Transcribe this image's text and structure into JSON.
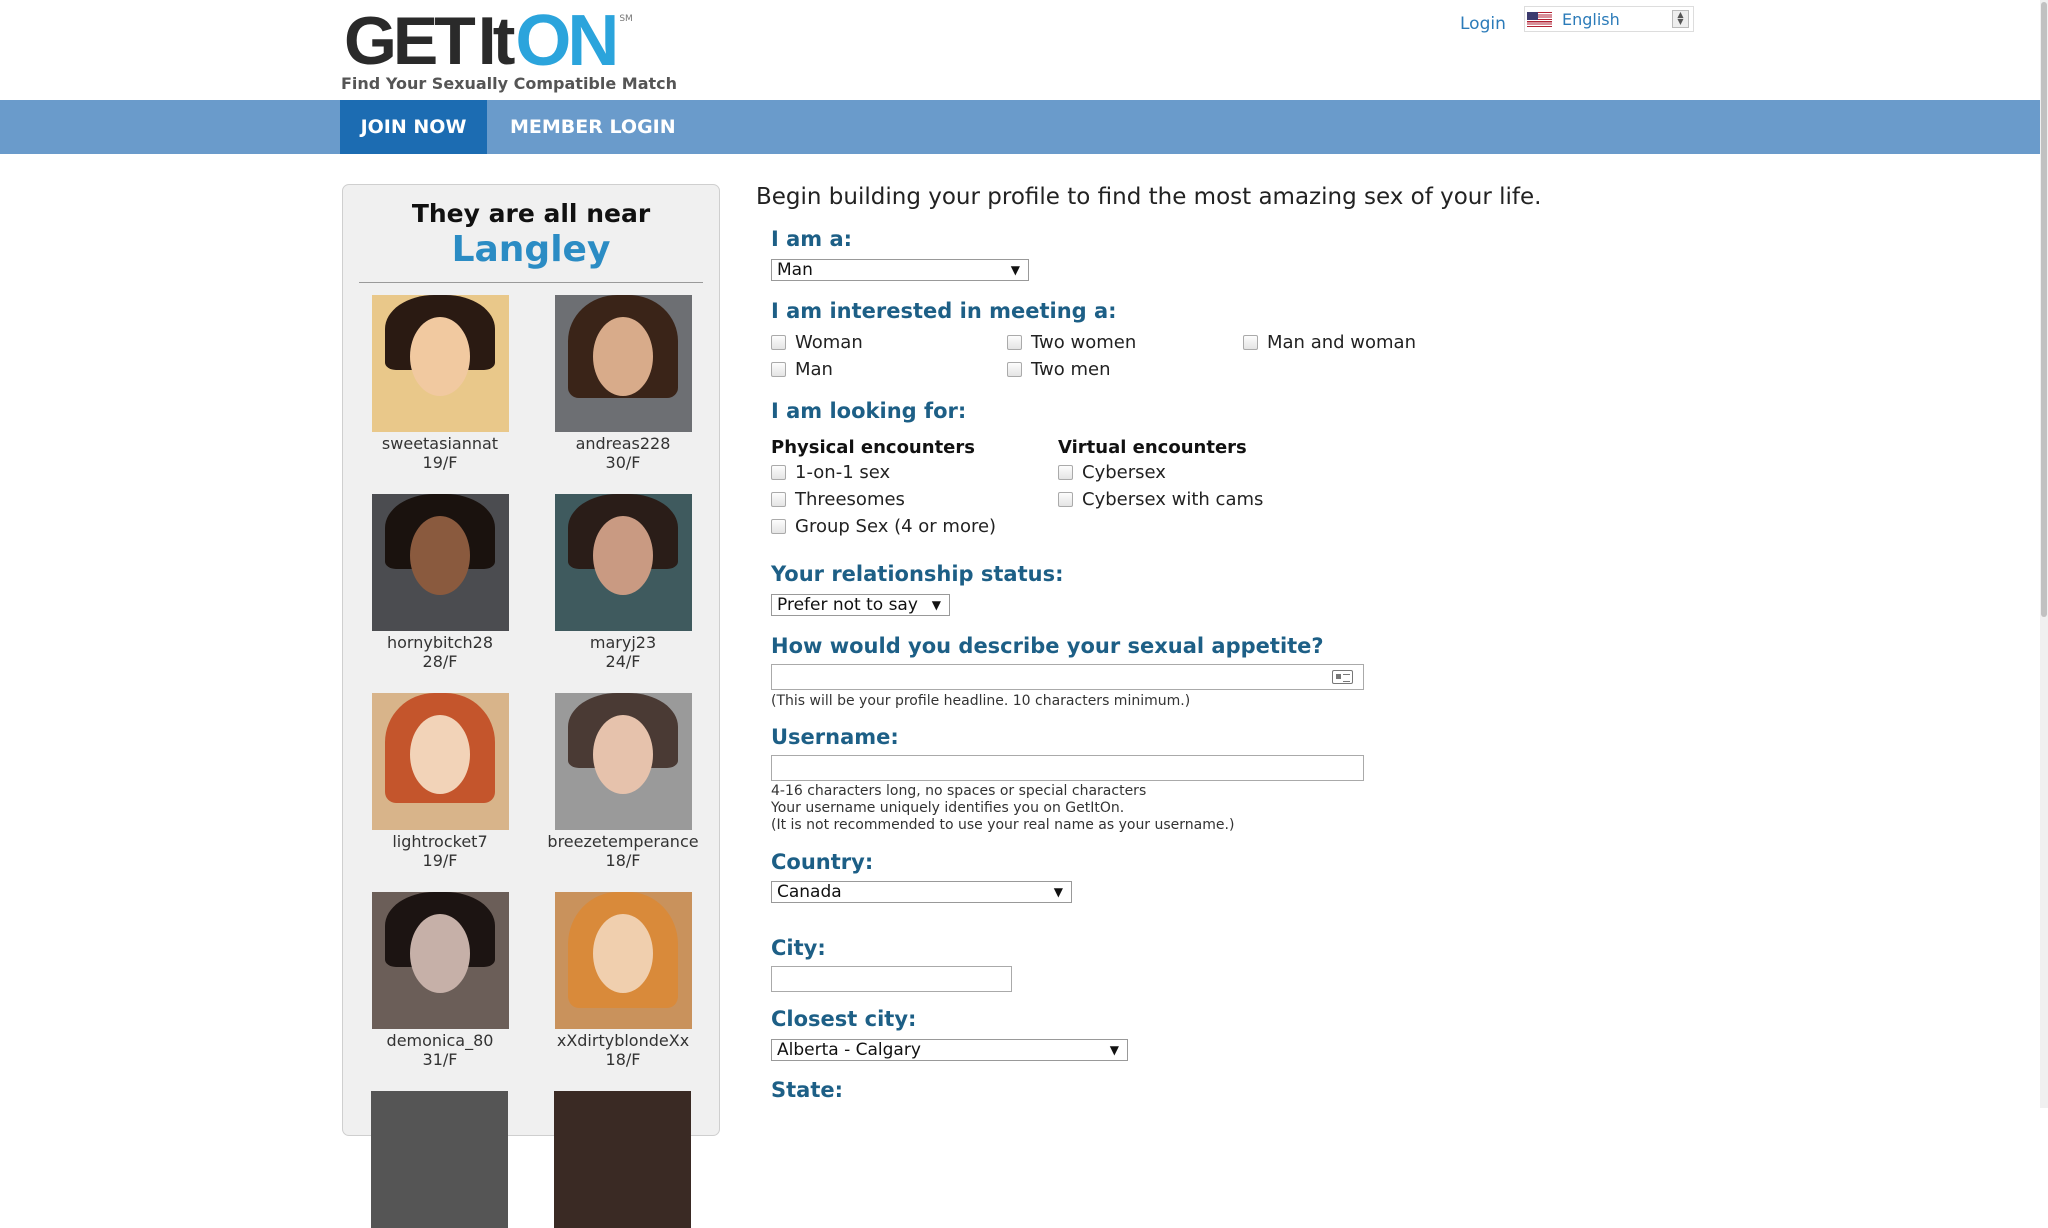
{
  "header": {
    "logo_get": "GET",
    "logo_it": "It",
    "logo_on": "ON",
    "logo_sm": "SM",
    "tagline": "Find Your Sexually Compatible Match",
    "login_label": "Login",
    "language": "English"
  },
  "nav": {
    "join_label": "JOIN NOW",
    "member_login_label": "MEMBER LOGIN"
  },
  "panel": {
    "title": "They are all near",
    "city": "Langley",
    "profiles": [
      {
        "name": "sweetasiannat",
        "age": "19/F"
      },
      {
        "name": "andreas228",
        "age": "30/F"
      },
      {
        "name": "hornybitch28",
        "age": "28/F"
      },
      {
        "name": "maryj23",
        "age": "24/F"
      },
      {
        "name": "lightrocket7",
        "age": "19/F"
      },
      {
        "name": "breezetemperance",
        "age": "18/F"
      },
      {
        "name": "demonica_80",
        "age": "31/F"
      },
      {
        "name": "xXdirtyblondeXx",
        "age": "18/F"
      }
    ]
  },
  "form": {
    "intro": "Begin building your profile to find the most amazing sex of your life.",
    "iam_label": "I am a:",
    "iam_value": "Man",
    "interested_label": "I am interested in meeting a:",
    "interested_options": [
      "Woman",
      "Two women",
      "Man and woman",
      "Man",
      "Two men"
    ],
    "looking_label": "I am looking for:",
    "physical_head": "Physical encounters",
    "physical_options": [
      "1-on-1 sex",
      "Threesomes",
      "Group Sex (4 or more)"
    ],
    "virtual_head": "Virtual encounters",
    "virtual_options": [
      "Cybersex",
      "Cybersex with cams"
    ],
    "relationship_label": "Your relationship status:",
    "relationship_value": "Prefer not to say",
    "appetite_label": "How would you describe your sexual appetite?",
    "appetite_hint": "(This will be your profile headline. 10 characters minimum.)",
    "username_label": "Username:",
    "username_hints": [
      "4-16 characters long, no spaces or special characters",
      "Your username uniquely identifies you on GetItOn.",
      "(It is not recommended to use your real name as your username.)"
    ],
    "country_label": "Country:",
    "country_value": "Canada",
    "city_label": "City:",
    "closest_city_label": "Closest city:",
    "closest_city_value": "Alberta - Calgary",
    "state_label": "State:"
  },
  "colors": {
    "nav_bar": "#6a9bcb",
    "nav_active": "#1c6cb2",
    "label_blue": "#1d5f86",
    "city_blue": "#2b8cc4",
    "logo_blue": "#2ba4dc"
  }
}
